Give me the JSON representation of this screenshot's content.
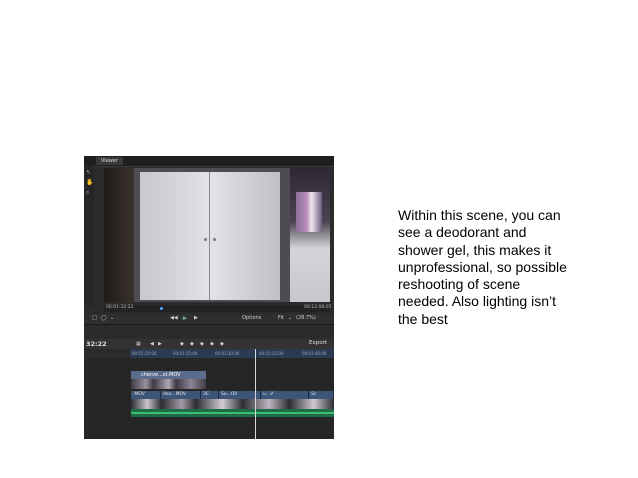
{
  "screenshot": {
    "viewer_tab": "Viewer",
    "timecode_left": "00:01:32:22",
    "timecode_right": "00:12:08:05",
    "controls": {
      "options": "Options",
      "fit": "Fit",
      "zoom": "(28.7%)"
    },
    "timeline": {
      "current_time": "32:22",
      "export_label": "Export",
      "ruler_ticks": [
        "00:01:20:00",
        "00:01:25:00",
        "00:01:30:00",
        "00:01:35:00",
        "00:01:40:00"
      ],
      "top_clip": "cherve...st.MOV",
      "main_clips": [
        {
          "label": ".MOV"
        },
        {
          "label": "deo...MOV"
        },
        {
          "label": "3C"
        },
        {
          "label": "So...OV"
        },
        {
          "label": "u...V"
        },
        {
          "label": "Sc"
        }
      ]
    }
  },
  "caption": {
    "lines": [
      "Within this scene, you can",
      "see a deodorant and",
      "shower gel, this makes it",
      "unprofessional, so possible",
      "reshooting of scene",
      "needed. Also lighting isn’t",
      "the best"
    ]
  }
}
